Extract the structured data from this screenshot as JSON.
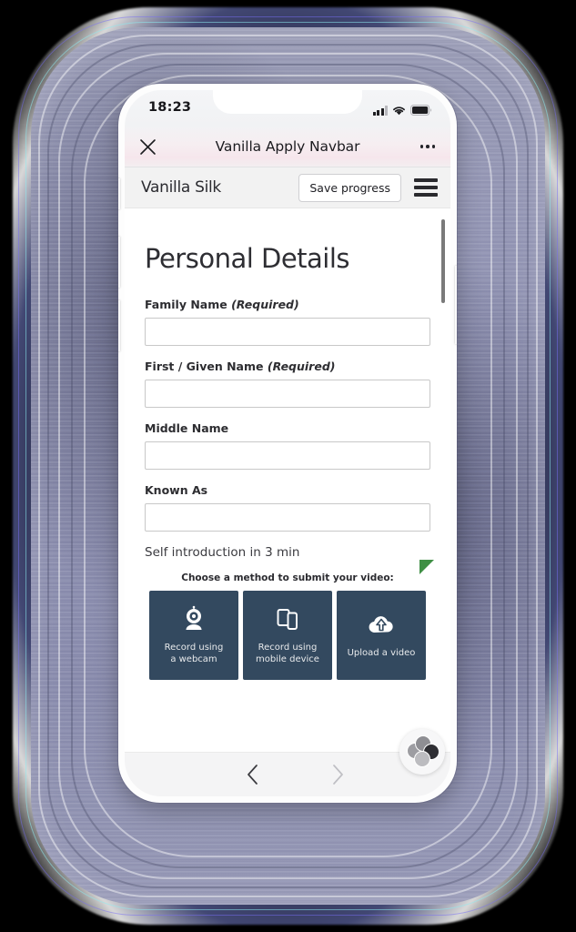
{
  "background": {
    "style": "smeared-purple-gray-halo",
    "base_color": "#8e90ae",
    "glow_color": "#7f86d4"
  },
  "phone": {
    "frame_color": "#fdfdfd",
    "side_buttons": [
      "silent-switch",
      "volume-up",
      "volume-down",
      "power"
    ]
  },
  "status_bar": {
    "time": "18:23",
    "signal_icon": "cellular-signal-icon",
    "signal_bars_filled": 3,
    "signal_bars_total": 4,
    "wifi_icon": "wifi-icon",
    "battery_icon": "battery-icon"
  },
  "navbar": {
    "close_icon": "close-icon",
    "title": "Vanilla Apply Navbar",
    "more_icon": "more-options-icon",
    "gradient_accent": "#f6e6ec"
  },
  "app_header": {
    "brand": "Vanilla Silk",
    "save_label": "Save progress",
    "menu_icon": "hamburger-menu-icon",
    "background": "#f2f2f2"
  },
  "form": {
    "title": "Personal Details",
    "fields": [
      {
        "label": "Family Name ",
        "required_text": "(Required)",
        "value": "",
        "placeholder": ""
      },
      {
        "label": "First / Given Name ",
        "required_text": "(Required)",
        "value": "",
        "placeholder": ""
      },
      {
        "label": "Middle Name",
        "required_text": "",
        "value": "",
        "placeholder": ""
      },
      {
        "label": "Known As",
        "required_text": "",
        "value": "",
        "placeholder": ""
      }
    ]
  },
  "video_section": {
    "heading": "Self introduction in 3 min",
    "flag_icon": "green-corner-flag-icon",
    "flag_color": "#3f8f44",
    "prompt": "Choose a method to submit your video:",
    "card_color": "#33495f",
    "methods": [
      {
        "icon": "webcam-icon",
        "label": "Record using\na webcam"
      },
      {
        "icon": "mobile-device-icon",
        "label": "Record using\nmobile device"
      },
      {
        "icon": "cloud-upload-icon",
        "label": "Upload a video"
      }
    ]
  },
  "bottom_bar": {
    "back_icon": "chevron-left-icon",
    "back_enabled": true,
    "forward_icon": "chevron-right-icon",
    "forward_enabled": false,
    "float_widget_icon": "bubble-cluster-icon"
  },
  "scrollbar": {
    "thumb_color": "#7a7a7a"
  }
}
